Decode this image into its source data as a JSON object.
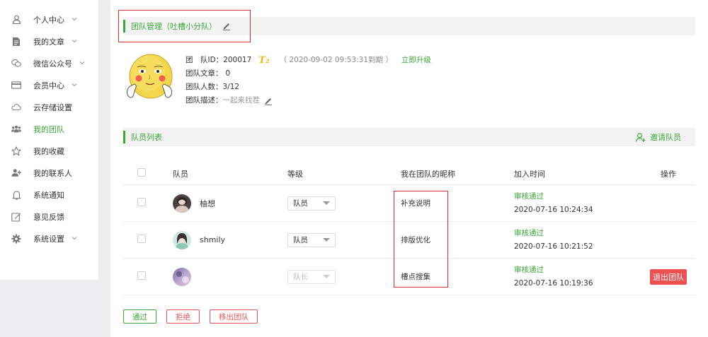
{
  "sidebar": {
    "items": [
      {
        "label": "个人中心",
        "icon": "user-icon",
        "chevron": "⌄"
      },
      {
        "label": "我的文章",
        "icon": "document-icon",
        "chevron": "⌄"
      },
      {
        "label": "微信公众号",
        "icon": "wechat-icon",
        "chevron": "⌄"
      },
      {
        "label": "会员中心",
        "icon": "card-icon",
        "chevron": "⌄"
      },
      {
        "label": "云存储设置",
        "icon": "cloud-icon",
        "chevron": ""
      },
      {
        "label": "我的团队",
        "icon": "team-icon",
        "chevron": "",
        "active": true
      },
      {
        "label": "我的收藏",
        "icon": "star-icon",
        "chevron": ""
      },
      {
        "label": "我的联系人",
        "icon": "add-contact-icon",
        "chevron": ""
      },
      {
        "label": "系统通知",
        "icon": "bell-icon",
        "chevron": ""
      },
      {
        "label": "意见反馈",
        "icon": "feedback-icon",
        "chevron": ""
      },
      {
        "label": "系统设置",
        "icon": "gear-icon",
        "chevron": "⌄"
      }
    ]
  },
  "team": {
    "header_title": "团队管理（吐槽小分队）",
    "id_label": "团　队ID：",
    "id_value": "200017",
    "tier_badge": "T₂",
    "expire_text": "（ 2020-09-02 09:53:31到期 ）",
    "upgrade_link": "立即升级",
    "articles_label": "团队文章：",
    "articles_value": "0",
    "members_label": "团队人数：",
    "members_value": "3/12",
    "desc_label": "团队描述：",
    "desc_value": "一起来找茬"
  },
  "members": {
    "section_title": "队员列表",
    "invite_label": "邀请队员",
    "columns": {
      "member": "队员",
      "level": "等级",
      "nickname": "我在团队的昵称",
      "joined": "加入时间",
      "actions": "操作"
    },
    "rows": [
      {
        "name": "柚想",
        "level": "队员",
        "level_disabled": false,
        "nickname": "补充说明",
        "status": "审核通过",
        "joined": "2020-07-16 10:24:34",
        "action": ""
      },
      {
        "name": "shmily",
        "level": "队员",
        "level_disabled": false,
        "nickname": "排版优化",
        "status": "审核通过",
        "joined": "2020-07-16 10:21:52",
        "action": ""
      },
      {
        "name": "",
        "level": "队长",
        "level_disabled": true,
        "nickname": "槽点搜集",
        "status": "审核通过",
        "joined": "2020-07-16 10:19:36",
        "action": "退出团队"
      }
    ]
  },
  "bottom_buttons": {
    "approve": "通过",
    "reject": "拒绝",
    "remove": "移出团队"
  },
  "colors": {
    "accent_green": "#3da838",
    "danger_red": "#ef5050",
    "highlight_box": "#e02e2e"
  }
}
